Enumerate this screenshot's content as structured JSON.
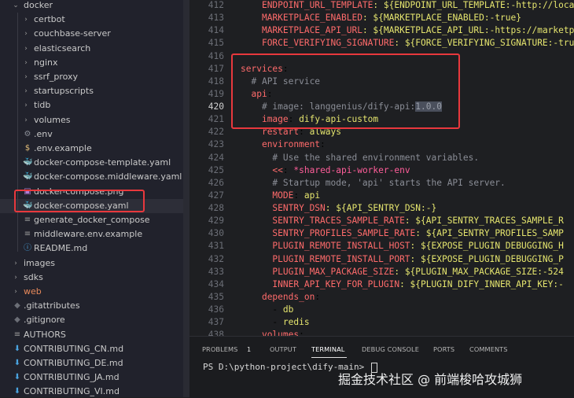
{
  "sidebar": {
    "items": [
      {
        "label": "docker",
        "kind": "folder",
        "expanded": true,
        "indent": 0
      },
      {
        "label": "certbot",
        "kind": "folder",
        "expanded": false,
        "indent": 1
      },
      {
        "label": "couchbase-server",
        "kind": "folder",
        "expanded": false,
        "indent": 1
      },
      {
        "label": "elasticsearch",
        "kind": "folder",
        "expanded": false,
        "indent": 1
      },
      {
        "label": "nginx",
        "kind": "folder",
        "expanded": false,
        "indent": 1
      },
      {
        "label": "ssrf_proxy",
        "kind": "folder",
        "expanded": false,
        "indent": 1
      },
      {
        "label": "startupscripts",
        "kind": "folder",
        "expanded": false,
        "indent": 1
      },
      {
        "label": "tidb",
        "kind": "folder",
        "expanded": false,
        "indent": 1
      },
      {
        "label": "volumes",
        "kind": "folder",
        "expanded": false,
        "indent": 1
      },
      {
        "label": ".env",
        "kind": "gear",
        "indent": 1
      },
      {
        "label": ".env.example",
        "kind": "dollar",
        "indent": 1
      },
      {
        "label": "docker-compose-template.yaml",
        "kind": "docker",
        "indent": 1
      },
      {
        "label": "docker-compose.middleware.yaml",
        "kind": "docker",
        "indent": 1
      },
      {
        "label": "docker-compose.png",
        "kind": "image",
        "indent": 1
      },
      {
        "label": "docker-compose.yaml",
        "kind": "docker",
        "indent": 1,
        "selected": true
      },
      {
        "label": "generate_docker_compose",
        "kind": "file",
        "indent": 1
      },
      {
        "label": "middleware.env.example",
        "kind": "file",
        "indent": 1
      },
      {
        "label": "README.md",
        "kind": "info",
        "indent": 1
      },
      {
        "label": "images",
        "kind": "folder",
        "expanded": false,
        "indent": 0
      },
      {
        "label": "sdks",
        "kind": "folder",
        "expanded": false,
        "indent": 0
      },
      {
        "label": "web",
        "kind": "folder",
        "expanded": false,
        "indent": 0,
        "modified": true
      },
      {
        "label": ".gitattributes",
        "kind": "git",
        "indent": 0
      },
      {
        "label": ".gitignore",
        "kind": "git",
        "indent": 0
      },
      {
        "label": "AUTHORS",
        "kind": "file",
        "indent": 0
      },
      {
        "label": "CONTRIBUTING_CN.md",
        "kind": "download",
        "indent": 0
      },
      {
        "label": "CONTRIBUTING_DE.md",
        "kind": "download",
        "indent": 0
      },
      {
        "label": "CONTRIBUTING_JA.md",
        "kind": "download",
        "indent": 0
      },
      {
        "label": "CONTRIBUTING_VI.md",
        "kind": "download",
        "indent": 0
      }
    ]
  },
  "editor": {
    "active_line": "420",
    "lines": [
      {
        "n": "412",
        "tokens": [
          {
            "t": "    "
          },
          {
            "t": "ENDPOINT_URL_TEMPLATE",
            "c": "k"
          },
          {
            "t": ": ${ENDPOINT_URL_TEMPLATE:-http://loca",
            "c": "s"
          }
        ]
      },
      {
        "n": "413",
        "tokens": [
          {
            "t": "    "
          },
          {
            "t": "MARKETPLACE_ENABLED",
            "c": "k"
          },
          {
            "t": ": ${MARKETPLACE_ENABLED:-true}",
            "c": "s"
          }
        ]
      },
      {
        "n": "414",
        "tokens": [
          {
            "t": "    "
          },
          {
            "t": "MARKETPLACE_API_URL",
            "c": "k"
          },
          {
            "t": ": ${MARKETPLACE_API_URL:-https://marketp",
            "c": "s"
          }
        ]
      },
      {
        "n": "415",
        "tokens": [
          {
            "t": "    "
          },
          {
            "t": "FORCE_VERIFYING_SIGNATURE",
            "c": "k"
          },
          {
            "t": ": ${FORCE_VERIFYING_SIGNATURE:-tru",
            "c": "s"
          }
        ]
      },
      {
        "n": "416",
        "tokens": []
      },
      {
        "n": "417",
        "tokens": [
          {
            "t": "services",
            "c": "k"
          },
          {
            "t": ":"
          }
        ]
      },
      {
        "n": "418",
        "tokens": [
          {
            "t": "  "
          },
          {
            "t": "# API service",
            "c": "c"
          }
        ]
      },
      {
        "n": "419",
        "tokens": [
          {
            "t": "  "
          },
          {
            "t": "api",
            "c": "k"
          },
          {
            "t": ":"
          }
        ]
      },
      {
        "n": "420",
        "tokens": [
          {
            "t": "    "
          },
          {
            "t": "# image: langgenius/dify-api:",
            "c": "c"
          },
          {
            "t": "1.0.0",
            "c": "sel"
          }
        ]
      },
      {
        "n": "421",
        "tokens": [
          {
            "t": "    "
          },
          {
            "t": "image",
            "c": "k"
          },
          {
            "t": ": "
          },
          {
            "t": "dify-api-custom",
            "c": "s"
          }
        ]
      },
      {
        "n": "422",
        "tokens": [
          {
            "t": "    "
          },
          {
            "t": "restart",
            "c": "k"
          },
          {
            "t": ": "
          },
          {
            "t": "always",
            "c": "s"
          }
        ]
      },
      {
        "n": "423",
        "tokens": [
          {
            "t": "    "
          },
          {
            "t": "environment",
            "c": "k"
          },
          {
            "t": ":"
          }
        ]
      },
      {
        "n": "424",
        "tokens": [
          {
            "t": "      "
          },
          {
            "t": "# Use the shared environment variables.",
            "c": "c"
          }
        ]
      },
      {
        "n": "425",
        "tokens": [
          {
            "t": "      "
          },
          {
            "t": "<<",
            "c": "k"
          },
          {
            "t": ": "
          },
          {
            "t": "*shared-api-worker-env",
            "c": "a"
          }
        ]
      },
      {
        "n": "426",
        "tokens": [
          {
            "t": "      "
          },
          {
            "t": "# Startup mode, 'api' starts the API server.",
            "c": "c"
          }
        ]
      },
      {
        "n": "427",
        "tokens": [
          {
            "t": "      "
          },
          {
            "t": "MODE",
            "c": "k"
          },
          {
            "t": ": "
          },
          {
            "t": "api",
            "c": "s"
          }
        ]
      },
      {
        "n": "428",
        "tokens": [
          {
            "t": "      "
          },
          {
            "t": "SENTRY_DSN",
            "c": "k"
          },
          {
            "t": ": ${API_SENTRY_DSN:-}",
            "c": "s"
          }
        ]
      },
      {
        "n": "429",
        "tokens": [
          {
            "t": "      "
          },
          {
            "t": "SENTRY_TRACES_SAMPLE_RATE",
            "c": "k"
          },
          {
            "t": ": ${API_SENTRY_TRACES_SAMPLE_R",
            "c": "s"
          }
        ]
      },
      {
        "n": "430",
        "tokens": [
          {
            "t": "      "
          },
          {
            "t": "SENTRY_PROFILES_SAMPLE_RATE",
            "c": "k"
          },
          {
            "t": ": ${API_SENTRY_PROFILES_SAMP",
            "c": "s"
          }
        ]
      },
      {
        "n": "431",
        "tokens": [
          {
            "t": "      "
          },
          {
            "t": "PLUGIN_REMOTE_INSTALL_HOST",
            "c": "k"
          },
          {
            "t": ": ${EXPOSE_PLUGIN_DEBUGGING_H",
            "c": "s"
          }
        ]
      },
      {
        "n": "432",
        "tokens": [
          {
            "t": "      "
          },
          {
            "t": "PLUGIN_REMOTE_INSTALL_PORT",
            "c": "k"
          },
          {
            "t": ": ${EXPOSE_PLUGIN_DEBUGGING_P",
            "c": "s"
          }
        ]
      },
      {
        "n": "433",
        "tokens": [
          {
            "t": "      "
          },
          {
            "t": "PLUGIN_MAX_PACKAGE_SIZE",
            "c": "k"
          },
          {
            "t": ": ${PLUGIN_MAX_PACKAGE_SIZE:-524",
            "c": "s"
          }
        ]
      },
      {
        "n": "434",
        "tokens": [
          {
            "t": "      "
          },
          {
            "t": "INNER_API_KEY_FOR_PLUGIN",
            "c": "k"
          },
          {
            "t": ": ${PLUGIN_DIFY_INNER_API_KEY:-",
            "c": "s"
          }
        ]
      },
      {
        "n": "435",
        "tokens": [
          {
            "t": "    "
          },
          {
            "t": "depends_on",
            "c": "k"
          },
          {
            "t": ":"
          }
        ]
      },
      {
        "n": "436",
        "tokens": [
          {
            "t": "      - "
          },
          {
            "t": "db",
            "c": "s"
          }
        ]
      },
      {
        "n": "437",
        "tokens": [
          {
            "t": "      - "
          },
          {
            "t": "redis",
            "c": "s"
          }
        ]
      },
      {
        "n": "438",
        "tokens": [
          {
            "t": "    "
          },
          {
            "t": "volumes",
            "c": "k"
          },
          {
            "t": ":"
          }
        ]
      }
    ]
  },
  "panel": {
    "tabs": [
      {
        "label": "PROBLEMS",
        "badge": "1"
      },
      {
        "label": "OUTPUT"
      },
      {
        "label": "TERMINAL",
        "active": true
      },
      {
        "label": "DEBUG CONSOLE"
      },
      {
        "label": "PORTS"
      },
      {
        "label": "COMMENTS"
      }
    ],
    "terminal_prompt": "PS D:\\python-project\\dify-main> "
  },
  "watermark": "掘金技术社区 @ 前端梭哈攻城狮",
  "colors": {
    "highlight_box": "#e8383d",
    "key": "#ff6b6b",
    "string": "#e5e56e",
    "comment": "#8a8d96",
    "alias": "#ff5e9a",
    "docker_icon": "#3b9ee6",
    "folder_modified": "#e98a5b"
  }
}
